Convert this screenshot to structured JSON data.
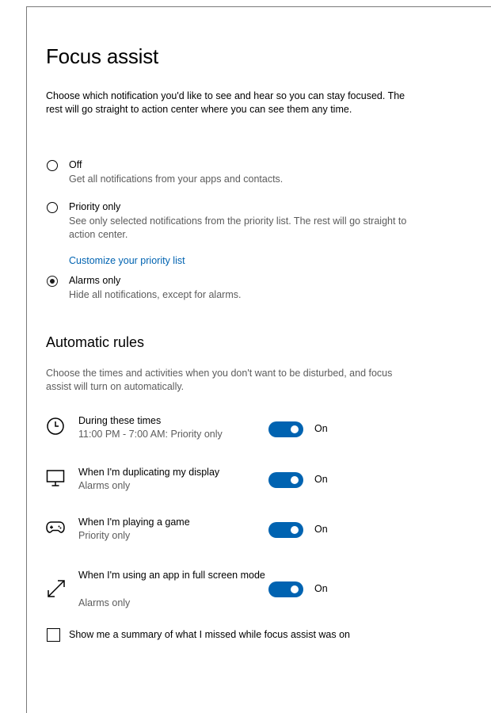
{
  "page": {
    "title": "Focus assist",
    "intro": "Choose which notification you'd like to see and hear so you can stay focused. The rest will go straight to action center where you can see them any time."
  },
  "modes": [
    {
      "label": "Off",
      "description": "Get all notifications from your apps and contacts.",
      "selected": false
    },
    {
      "label": "Priority only",
      "description": "See only selected notifications from the priority list. The rest will go straight to action center.",
      "link": "Customize your priority list",
      "selected": false
    },
    {
      "label": "Alarms only",
      "description": "Hide all notifications, except for alarms.",
      "selected": true
    }
  ],
  "automatic_rules": {
    "heading": "Automatic rules",
    "description": "Choose the times and activities when you don't want to be disturbed, and focus assist will turn on automatically.",
    "rules": [
      {
        "title": "During these times",
        "subtitle": "11:00 PM - 7:00 AM: Priority only",
        "state": "On",
        "icon": "clock-icon"
      },
      {
        "title": "When I'm duplicating my display",
        "subtitle": "Alarms only",
        "state": "On",
        "icon": "monitor-icon"
      },
      {
        "title": "When I'm playing a game",
        "subtitle": "Priority only",
        "state": "On",
        "icon": "gamepad-icon"
      },
      {
        "title": "When I'm using an app in full screen mode",
        "subtitle": "Alarms only",
        "state": "On",
        "icon": "fullscreen-icon"
      }
    ]
  },
  "summary_checkbox": {
    "label": "Show me a summary of what I missed while focus assist was on",
    "checked": false
  },
  "colors": {
    "accent": "#0063b1",
    "secondary_text": "#5c5c5c"
  }
}
